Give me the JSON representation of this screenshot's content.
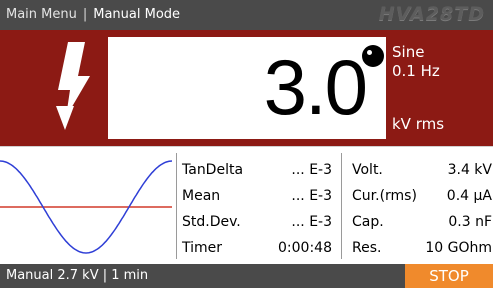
{
  "topbar": {
    "main_menu": "Main Menu",
    "separator": "|",
    "mode": "Manual Mode",
    "model": "HVA28TD"
  },
  "readout": {
    "value": "3.0",
    "waveform": "Sine",
    "frequency": "0.1 Hz",
    "unit": "kV rms"
  },
  "measurements_left": [
    {
      "label": "TanDelta",
      "value": "... E-3"
    },
    {
      "label": "Mean",
      "value": "... E-3"
    },
    {
      "label": "Std.Dev.",
      "value": "... E-3"
    },
    {
      "label": "Timer",
      "value": "0:00:48"
    }
  ],
  "measurements_right": [
    {
      "label": "Volt.",
      "value": "3.4 kV"
    },
    {
      "label": "Cur.(rms)",
      "value": "0.4 µA"
    },
    {
      "label": "Cap.",
      "value": "0.3 nF"
    },
    {
      "label": "Res.",
      "value": "10 GOhm"
    }
  ],
  "bottombar": {
    "status": "Manual 2.7 kV | 1 min",
    "stop_label": "STOP"
  },
  "colors": {
    "panel_red": "#8c1a14",
    "bar_gray": "#4a4a4a",
    "stop_orange": "#f08a2c",
    "sine_blue": "#2f3fd6",
    "zero_line_red": "#d23a2a"
  },
  "icons": {
    "high_voltage": "high-voltage-icon",
    "status_dot": "status-dot-icon"
  }
}
